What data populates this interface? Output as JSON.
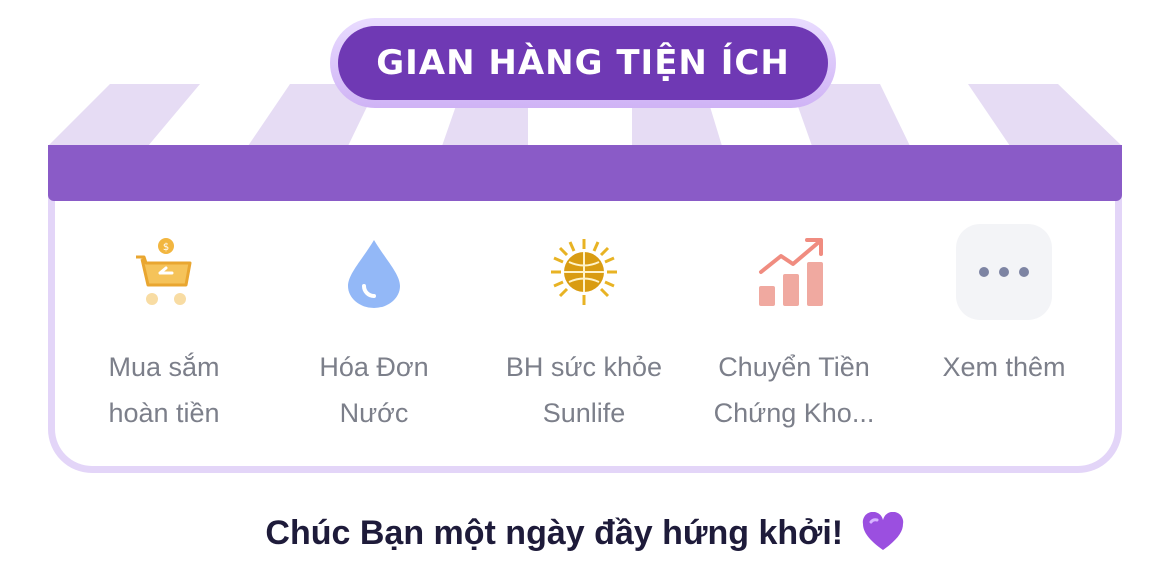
{
  "header": {
    "title": "GIAN HÀNG TIỆN ÍCH"
  },
  "items": [
    {
      "icon": "cart-cashback-icon",
      "label_line1": "Mua sắm",
      "label_line2": "hoàn tiền"
    },
    {
      "icon": "water-drop-icon",
      "label_line1": "Hóa Đơn",
      "label_line2": "Nước"
    },
    {
      "icon": "sunlife-logo-icon",
      "label_line1": "BH sức khỏe",
      "label_line2": "Sunlife"
    },
    {
      "icon": "stock-chart-icon",
      "label_line1": "Chuyển Tiền",
      "label_line2": "Chứng Kho..."
    },
    {
      "icon": "more-dots-icon",
      "label_line1": "Xem thêm",
      "label_line2": ""
    }
  ],
  "footer": {
    "greeting": "Chúc Bạn một ngày đầy hứng khởi!",
    "emoji": "purple-heart-icon"
  },
  "colors": {
    "accent": "#6f39b4",
    "valance": "#8a5bc7",
    "stripe": "#e6dcf4",
    "border": "#e3d5f8"
  }
}
